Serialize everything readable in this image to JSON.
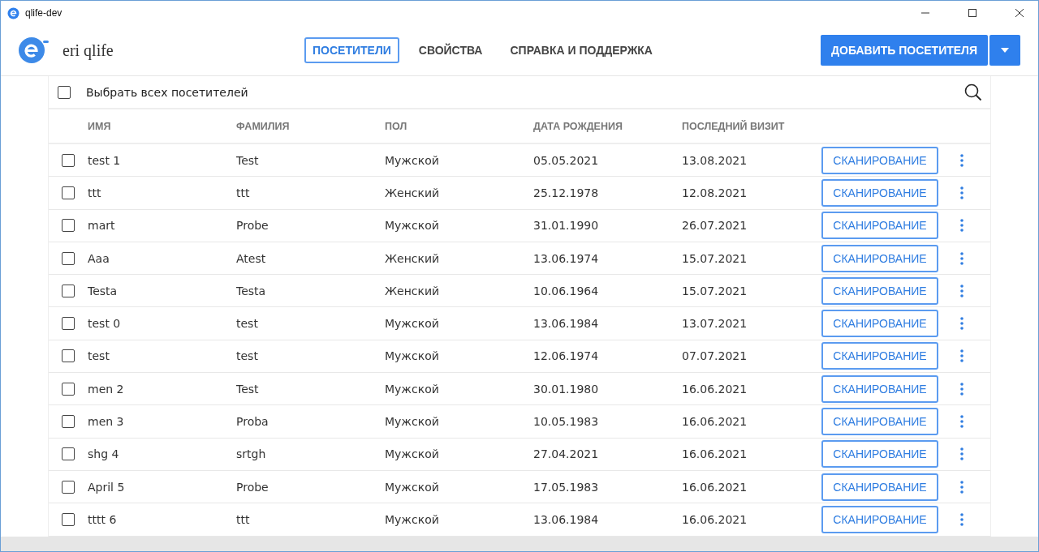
{
  "window": {
    "title": "qlife-dev"
  },
  "app": {
    "name": "eri qlife"
  },
  "tabs": [
    {
      "label": "ПОСЕТИТЕЛИ",
      "selected": true
    },
    {
      "label": "СВОЙСТВА",
      "selected": false
    },
    {
      "label": "СПРАВКА И ПОДДЕРЖКА",
      "selected": false
    }
  ],
  "add_button": {
    "label": "ДОБАВИТЬ ПОСЕТИТЕЛЯ"
  },
  "select_all": {
    "label": "Выбрать всех посетителей",
    "checked": false
  },
  "table": {
    "columns": [
      "ИМЯ",
      "ФАМИЛИЯ",
      "ПОЛ",
      "ДАТА РОЖДЕНИЯ",
      "ПОСЛЕДНИЙ ВИЗИТ"
    ],
    "rows": [
      {
        "checked": false,
        "cells": [
          "test 1",
          "Test",
          "Мужской",
          "05.05.2021",
          "13.08.2021"
        ],
        "action": "СКАНИРОВАНИЕ"
      },
      {
        "checked": false,
        "cells": [
          "ttt",
          "ttt",
          "Женский",
          "25.12.1978",
          "12.08.2021"
        ],
        "action": "СКАНИРОВАНИЕ"
      },
      {
        "checked": false,
        "cells": [
          "mart",
          "Probe",
          "Мужской",
          "31.01.1990",
          "26.07.2021"
        ],
        "action": "СКАНИРОВАНИЕ"
      },
      {
        "checked": false,
        "cells": [
          "Aaa",
          "Atest",
          "Женский",
          "13.06.1974",
          "15.07.2021"
        ],
        "action": "СКАНИРОВАНИЕ"
      },
      {
        "checked": false,
        "cells": [
          "Testa",
          "Testa",
          "Женский",
          "10.06.1964",
          "15.07.2021"
        ],
        "action": "СКАНИРОВАНИЕ"
      },
      {
        "checked": false,
        "cells": [
          "test 0",
          "test",
          "Мужской",
          "13.06.1984",
          "13.07.2021"
        ],
        "action": "СКАНИРОВАНИЕ"
      },
      {
        "checked": false,
        "cells": [
          "test",
          "test",
          "Мужской",
          "12.06.1974",
          "07.07.2021"
        ],
        "action": "СКАНИРОВАНИЕ"
      },
      {
        "checked": false,
        "cells": [
          "men 2",
          "Test",
          "Мужской",
          "30.01.1980",
          "16.06.2021"
        ],
        "action": "СКАНИРОВАНИЕ"
      },
      {
        "checked": false,
        "cells": [
          "men 3",
          "Proba",
          "Мужской",
          "10.05.1983",
          "16.06.2021"
        ],
        "action": "СКАНИРОВАНИЕ"
      },
      {
        "checked": false,
        "cells": [
          "shg 4",
          "srtgh",
          "Мужской",
          "27.04.2021",
          "16.06.2021"
        ],
        "action": "СКАНИРОВАНИЕ"
      },
      {
        "checked": false,
        "cells": [
          "April 5",
          "Probe",
          "Мужской",
          "17.05.1983",
          "16.06.2021"
        ],
        "action": "СКАНИРОВАНИЕ"
      },
      {
        "checked": false,
        "cells": [
          "tttt 6",
          "ttt",
          "Мужской",
          "13.06.1984",
          "16.06.2021"
        ],
        "action": "СКАНИРОВАНИЕ"
      }
    ]
  }
}
